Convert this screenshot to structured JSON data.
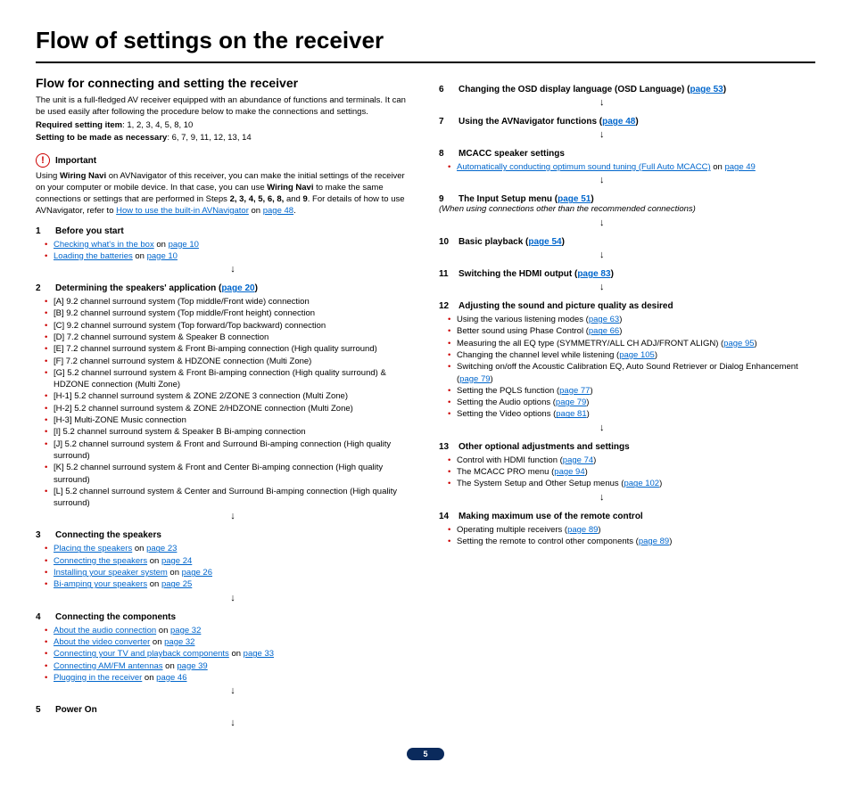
{
  "title": "Flow of settings on the receiver",
  "subtitle": "Flow for connecting and setting the receiver",
  "intro": "The unit is a full-fledged AV receiver equipped with an abundance of functions and terminals. It can be used easily after following the procedure below to make the connections and settings.",
  "req_label": "Required setting item",
  "req_val": ": 1, 2, 3, 4, 5, 8, 10",
  "setting_label": "Setting to be made as necessary",
  "setting_val": ": 6, 7, 9, 11, 12, 13, 14",
  "important": "Important",
  "important_body_a": "Using ",
  "important_body_b": "Wiring Navi",
  "important_body_c": " on AVNavigator of this receiver, you can make the initial settings of the receiver on your computer or mobile device. In that case, you can use ",
  "important_body_d": "Wiring Navi",
  "important_body_e": " to make the same connections or settings that are performed in Steps ",
  "important_body_f": "2, 3, 4, 5, 6, 8,",
  "important_body_g": " and ",
  "important_body_h": "9",
  "important_body_i": ". For details of how to use AVNavigator, refer to ",
  "important_link": "How to use the built-in AVNavigator",
  "important_on": " on ",
  "important_page": "page 48",
  "s1": {
    "num": "1",
    "title": "Before you start",
    "b1": "Checking what's in the box",
    "b1p": "page 10",
    "b2": "Loading the batteries",
    "b2p": "page 10"
  },
  "s2": {
    "num": "2",
    "title": "Determining the speakers' application (",
    "link": "page 20",
    "close": ")",
    "items": [
      "[A] 9.2 channel surround system (Top middle/Front wide) connection",
      "[B] 9.2 channel surround system (Top middle/Front height) connection",
      "[C] 9.2 channel surround system (Top forward/Top backward) connection",
      "[D] 7.2 channel surround system & Speaker B connection",
      "[E] 7.2 channel surround system & Front Bi-amping connection (High quality surround)",
      "[F] 7.2 channel surround system & HDZONE connection (Multi Zone)",
      "[G] 5.2 channel surround system & Front Bi-amping connection (High quality surround) & HDZONE connection (Multi Zone)",
      "[H-1] 5.2 channel surround system & ZONE 2/ZONE 3 connection (Multi Zone)",
      "[H-2] 5.2 channel surround system & ZONE 2/HDZONE connection (Multi Zone)",
      "[H-3] Multi-ZONE Music connection",
      "[I] 5.2 channel surround system & Speaker B Bi-amping connection",
      "[J] 5.2 channel surround system & Front and Surround Bi-amping connection (High quality surround)",
      "[K] 5.2 channel surround system & Front and Center Bi-amping connection (High quality surround)",
      "[L] 5.2 channel surround system & Center and Surround Bi-amping connection (High quality surround)"
    ]
  },
  "s3": {
    "num": "3",
    "title": "Connecting the speakers",
    "rows": [
      {
        "t": "Placing the speakers",
        "p": "page 23"
      },
      {
        "t": "Connecting the speakers",
        "p": "page 24"
      },
      {
        "t": "Installing your speaker system",
        "p": "page 26"
      },
      {
        "t": "Bi-amping your speakers",
        "p": "page 25"
      }
    ]
  },
  "s4": {
    "num": "4",
    "title": "Connecting the components",
    "rows": [
      {
        "t": "About the audio connection",
        "p": "page 32"
      },
      {
        "t": "About the video converter",
        "p": "page 32"
      },
      {
        "t": "Connecting your TV and playback components",
        "p": "page 33"
      },
      {
        "t": "Connecting AM/FM antennas",
        "p": "page 39"
      },
      {
        "t": "Plugging in the receiver",
        "p": "page 46"
      }
    ]
  },
  "s5": {
    "num": "5",
    "title": "Power On"
  },
  "s6": {
    "num": "6",
    "title": "Changing the OSD display language (OSD Language) (",
    "link": "page 53",
    "close": ")"
  },
  "s7": {
    "num": "7",
    "title": "Using the AVNavigator functions (",
    "link": "page 48",
    "close": ")"
  },
  "s8": {
    "num": "8",
    "title": "MCACC speaker settings",
    "row": {
      "t": "Automatically conducting optimum sound tuning (Full Auto MCACC)",
      "p": "page 49"
    }
  },
  "s9": {
    "num": "9",
    "title": "The Input Setup menu (",
    "link": "page 51",
    "close": ")",
    "note": "(When using connections other than the recommended connections)"
  },
  "s10": {
    "num": "10",
    "title": "Basic playback (",
    "link": "page 54",
    "close": ")"
  },
  "s11": {
    "num": "11",
    "title": "Switching the HDMI output (",
    "link": "page 83",
    "close": ")"
  },
  "s12": {
    "num": "12",
    "title": "Adjusting the sound and picture quality as desired",
    "rows": [
      {
        "pre": "Using the various listening modes (",
        "link": "page 63",
        "post": ")"
      },
      {
        "pre": "Better sound using Phase Control (",
        "link": "page 66",
        "post": ")"
      },
      {
        "pre": "Measuring the all EQ type (SYMMETRY/ALL CH ADJ/FRONT ALIGN) (",
        "link": "page 95",
        "post": ")"
      },
      {
        "pre": "Changing the channel level while listening (",
        "link": "page 105",
        "post": ")"
      },
      {
        "pre": "Switching on/off the Acoustic Calibration EQ, Auto Sound Retriever or Dialog Enhancement (",
        "link": "page 79",
        "post": ")"
      },
      {
        "pre": "Setting the PQLS function (",
        "link": "page 77",
        "post": ")"
      },
      {
        "pre": "Setting the Audio options (",
        "link": "page 79",
        "post": ")"
      },
      {
        "pre": "Setting the Video options (",
        "link": "page 81",
        "post": ")"
      }
    ]
  },
  "s13": {
    "num": "13",
    "title": "Other optional adjustments and settings",
    "rows": [
      {
        "pre": "Control with HDMI function (",
        "link": "page 74",
        "post": ")"
      },
      {
        "pre": "The MCACC PRO menu (",
        "link": "page 94",
        "post": ")"
      },
      {
        "pre": "The System Setup and Other Setup menus (",
        "link": "page 102",
        "post": ")"
      }
    ]
  },
  "s14": {
    "num": "14",
    "title": "Making maximum use of the remote control",
    "rows": [
      {
        "pre": "Operating multiple receivers (",
        "link": "page 89",
        "post": ")"
      },
      {
        "pre": "Setting the remote to control other components (",
        "link": "page 89",
        "post": ")"
      }
    ]
  },
  "on": " on ",
  "pagenum": "5",
  "arrow": "↓"
}
